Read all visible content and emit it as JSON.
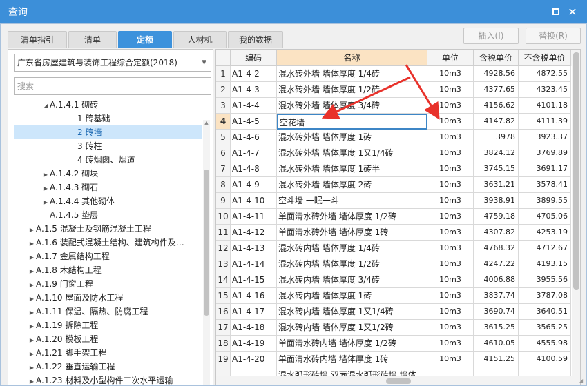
{
  "window": {
    "title": "查询"
  },
  "tabs": [
    {
      "label": "清单指引",
      "active": false
    },
    {
      "label": "清单",
      "active": false
    },
    {
      "label": "定额",
      "active": true
    },
    {
      "label": "人材机",
      "active": false
    },
    {
      "label": "我的数据",
      "active": false
    }
  ],
  "actions": {
    "insert": "插入(I)",
    "replace": "替换(R)"
  },
  "left": {
    "library": "广东省房屋建筑与装饰工程综合定额(2018)",
    "search_placeholder": "搜索",
    "tree": [
      {
        "label": "A.1.4.1 砌砖",
        "arrow": "expanded",
        "indent": 2,
        "selected": false
      },
      {
        "label": "1 砖基础",
        "arrow": "none",
        "indent": 4,
        "selected": false
      },
      {
        "label": "2 砖墙",
        "arrow": "none",
        "indent": 4,
        "selected": true
      },
      {
        "label": "3 砖柱",
        "arrow": "none",
        "indent": 4,
        "selected": false
      },
      {
        "label": "4 砖烟囱、烟道",
        "arrow": "none",
        "indent": 4,
        "selected": false
      },
      {
        "label": "A.1.4.2 砌块",
        "arrow": "collapsed",
        "indent": 2,
        "selected": false
      },
      {
        "label": "A.1.4.3 砌石",
        "arrow": "collapsed",
        "indent": 2,
        "selected": false
      },
      {
        "label": "A.1.4.4 其他砌体",
        "arrow": "collapsed",
        "indent": 2,
        "selected": false
      },
      {
        "label": "A.1.4.5 垫层",
        "arrow": "none",
        "indent": 2,
        "selected": false
      },
      {
        "label": "A.1.5 混凝土及钢筋混凝土工程",
        "arrow": "collapsed",
        "indent": 1,
        "selected": false
      },
      {
        "label": "A.1.6 装配式混凝土结构、建筑构件及…",
        "arrow": "collapsed",
        "indent": 1,
        "selected": false
      },
      {
        "label": "A.1.7 金属结构工程",
        "arrow": "collapsed",
        "indent": 1,
        "selected": false
      },
      {
        "label": "A.1.8 木结构工程",
        "arrow": "collapsed",
        "indent": 1,
        "selected": false
      },
      {
        "label": "A.1.9 门窗工程",
        "arrow": "collapsed",
        "indent": 1,
        "selected": false
      },
      {
        "label": "A.1.10 屋面及防水工程",
        "arrow": "collapsed",
        "indent": 1,
        "selected": false
      },
      {
        "label": "A.1.11 保温、隔热、防腐工程",
        "arrow": "collapsed",
        "indent": 1,
        "selected": false
      },
      {
        "label": "A.1.19 拆除工程",
        "arrow": "collapsed",
        "indent": 1,
        "selected": false
      },
      {
        "label": "A.1.20 模板工程",
        "arrow": "collapsed",
        "indent": 1,
        "selected": false
      },
      {
        "label": "A.1.21 脚手架工程",
        "arrow": "collapsed",
        "indent": 1,
        "selected": false
      },
      {
        "label": "A.1.22 垂直运输工程",
        "arrow": "collapsed",
        "indent": 1,
        "selected": false
      },
      {
        "label": "A.1.23 材料及小型构件二次水平运输",
        "arrow": "collapsed",
        "indent": 1,
        "selected": false
      }
    ]
  },
  "grid": {
    "columns": [
      "编码",
      "名称",
      "单位",
      "含税单价",
      "不含税单价"
    ],
    "rows": [
      {
        "no": "1",
        "code": "A1-4-2",
        "name": "混水砖外墙 墙体厚度 1/4砖",
        "unit": "10m3",
        "tax": "4928.56",
        "notax": "4872.55"
      },
      {
        "no": "2",
        "code": "A1-4-3",
        "name": "混水砖外墙 墙体厚度 1/2砖",
        "unit": "10m3",
        "tax": "4377.65",
        "notax": "4323.45"
      },
      {
        "no": "3",
        "code": "A1-4-4",
        "name": "混水砖外墙 墙体厚度 3/4砖",
        "unit": "10m3",
        "tax": "4156.62",
        "notax": "4101.18"
      },
      {
        "no": "4",
        "code": "A1-4-5",
        "name": "空花墙",
        "unit": "10m3",
        "tax": "4147.82",
        "notax": "4111.39",
        "selected": true
      },
      {
        "no": "5",
        "code": "A1-4-6",
        "name": "混水砖外墙 墙体厚度 1砖",
        "unit": "10m3",
        "tax": "3978",
        "notax": "3923.37"
      },
      {
        "no": "6",
        "code": "A1-4-7",
        "name": "混水砖外墙 墙体厚度 1又1/4砖",
        "unit": "10m3",
        "tax": "3824.12",
        "notax": "3769.89"
      },
      {
        "no": "7",
        "code": "A1-4-8",
        "name": "混水砖外墙 墙体厚度 1砖半",
        "unit": "10m3",
        "tax": "3745.15",
        "notax": "3691.17"
      },
      {
        "no": "8",
        "code": "A1-4-9",
        "name": "混水砖外墙 墙体厚度 2砖",
        "unit": "10m3",
        "tax": "3631.21",
        "notax": "3578.41"
      },
      {
        "no": "9",
        "code": "A1-4-10",
        "name": "空斗墙 一眠一斗",
        "unit": "10m3",
        "tax": "3938.91",
        "notax": "3899.55"
      },
      {
        "no": "10",
        "code": "A1-4-11",
        "name": "单面清水砖外墙 墙体厚度 1/2砖",
        "unit": "10m3",
        "tax": "4759.18",
        "notax": "4705.06"
      },
      {
        "no": "11",
        "code": "A1-4-12",
        "name": "单面清水砖外墙 墙体厚度 1砖",
        "unit": "10m3",
        "tax": "4307.82",
        "notax": "4253.19"
      },
      {
        "no": "12",
        "code": "A1-4-13",
        "name": "混水砖内墙 墙体厚度 1/4砖",
        "unit": "10m3",
        "tax": "4768.32",
        "notax": "4712.67"
      },
      {
        "no": "13",
        "code": "A1-4-14",
        "name": "混水砖内墙 墙体厚度 1/2砖",
        "unit": "10m3",
        "tax": "4247.22",
        "notax": "4193.15"
      },
      {
        "no": "14",
        "code": "A1-4-15",
        "name": "混水砖内墙 墙体厚度 3/4砖",
        "unit": "10m3",
        "tax": "4006.88",
        "notax": "3955.56"
      },
      {
        "no": "15",
        "code": "A1-4-16",
        "name": "混水砖内墙 墙体厚度 1砖",
        "unit": "10m3",
        "tax": "3837.74",
        "notax": "3787.08"
      },
      {
        "no": "16",
        "code": "A1-4-17",
        "name": "混水砖内墙 墙体厚度 1又1/4砖",
        "unit": "10m3",
        "tax": "3690.74",
        "notax": "3640.51"
      },
      {
        "no": "17",
        "code": "A1-4-18",
        "name": "混水砖内墙 墙体厚度 1又1/2砖",
        "unit": "10m3",
        "tax": "3615.25",
        "notax": "3565.25"
      },
      {
        "no": "18",
        "code": "A1-4-19",
        "name": "单面清水砖内墙 墙体厚度 1/2砖",
        "unit": "10m3",
        "tax": "4610.05",
        "notax": "4555.98"
      },
      {
        "no": "19",
        "code": "A1-4-20",
        "name": "单面清水砖内墙 墙体厚度 1砖",
        "unit": "10m3",
        "tax": "4151.25",
        "notax": "4100.59"
      },
      {
        "no": "",
        "code": "",
        "name": "混水弧形砖墙 双面混水弧形砖墙 墙体",
        "unit": "",
        "tax": "",
        "notax": ""
      }
    ]
  },
  "colors": {
    "accent": "#3d92dc",
    "title_bar": "#3c8fd9",
    "arrow": "#e8322b",
    "header_highlight": "#fbe3c3"
  },
  "icons": {
    "maximize": "maximize-icon",
    "close": "close-icon"
  }
}
